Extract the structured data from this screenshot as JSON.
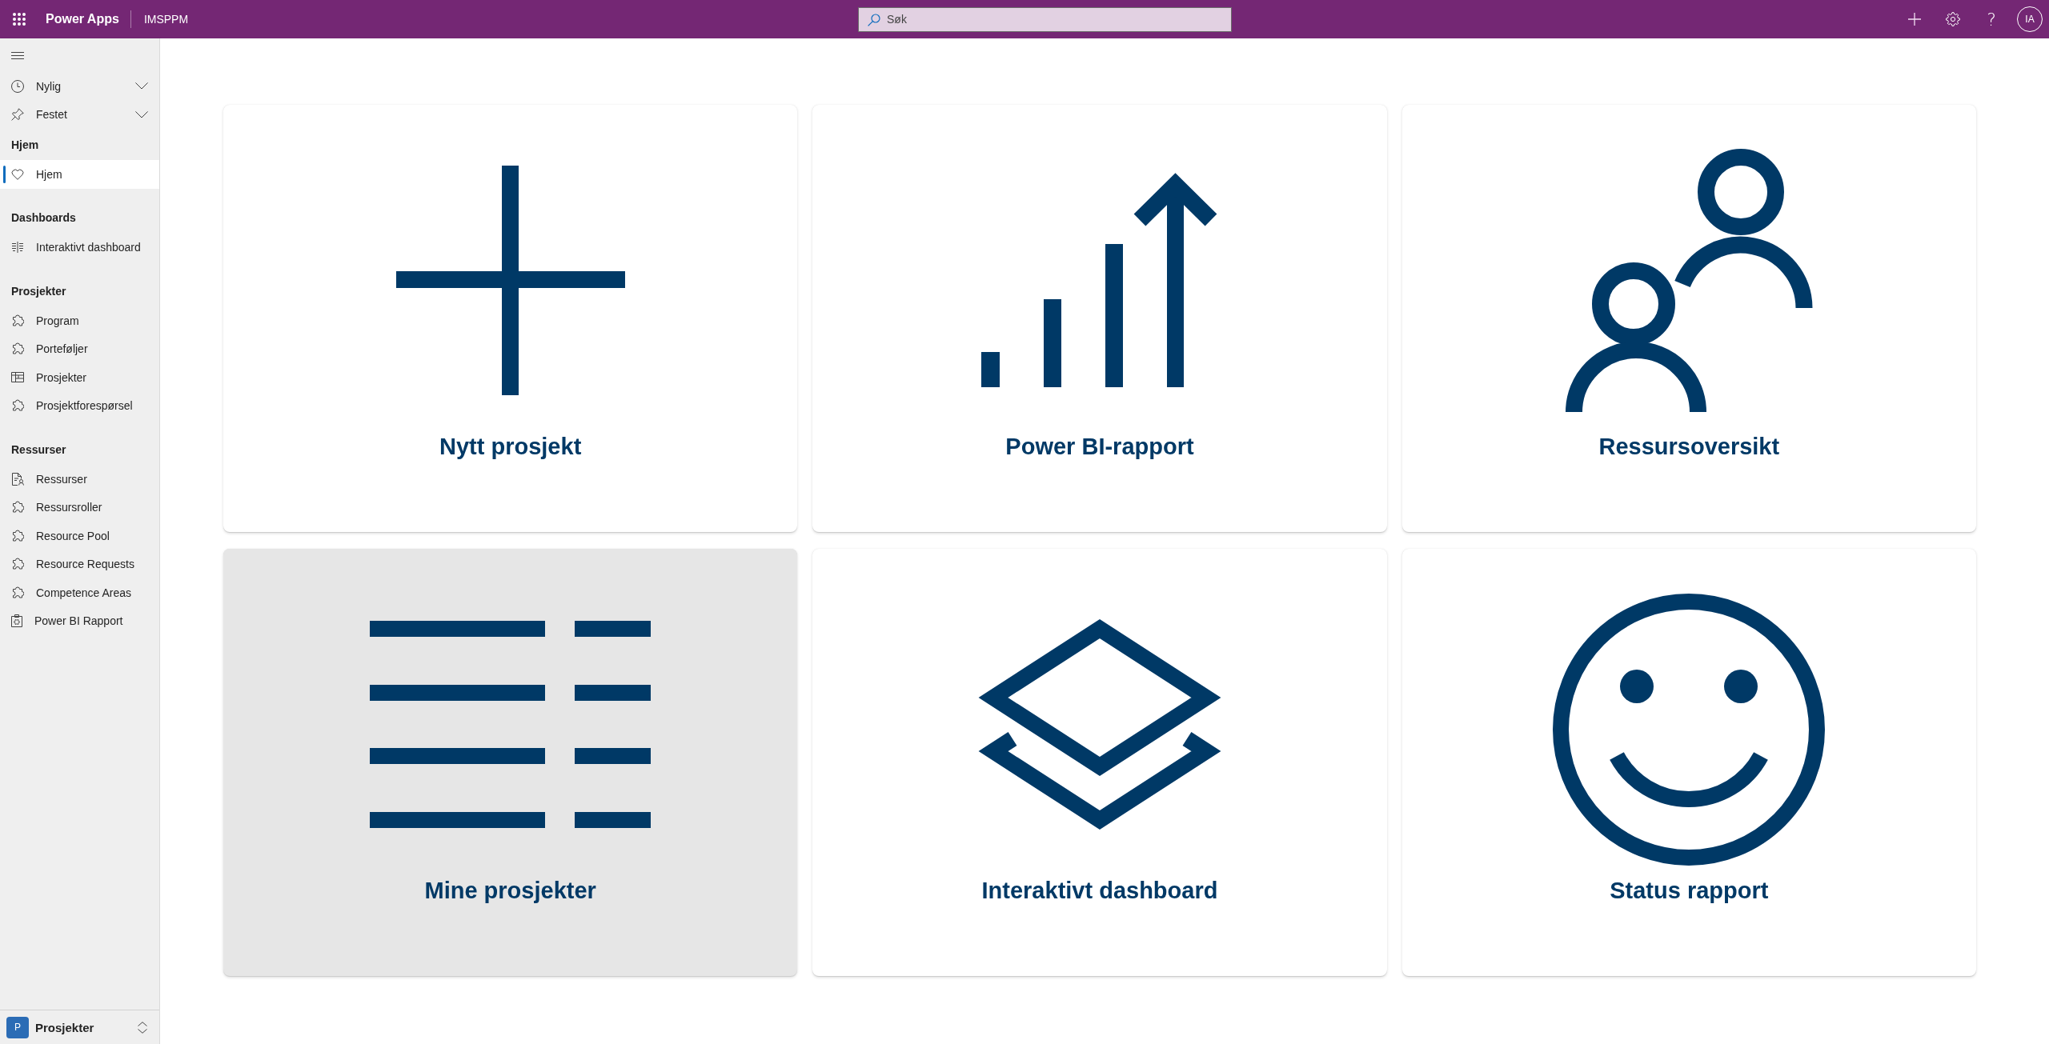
{
  "top_bar": {
    "app_name": "Power Apps",
    "environment": "IMSPPM",
    "search": {
      "placeholder": "Søk"
    },
    "help": "?",
    "avatar": "IA"
  },
  "sidebar": {
    "pinned_items": [
      {
        "label": "Nylig",
        "expanded": false
      },
      {
        "label": "Festet",
        "expanded": false
      }
    ],
    "sections": [
      {
        "heading": "Hjem",
        "items": [
          {
            "label": "Hjem",
            "selected": true
          }
        ]
      },
      {
        "heading": "Dashboards",
        "items": [
          {
            "label": "Interaktivt dashboard",
            "selected": false
          }
        ]
      },
      {
        "heading": "Prosjekter",
        "items": [
          {
            "label": "Program",
            "selected": false
          },
          {
            "label": "Porteføljer",
            "selected": false
          },
          {
            "label": "Prosjekter",
            "selected": false
          },
          {
            "label": "Prosjektforespørsel",
            "selected": false
          }
        ]
      },
      {
        "heading": "Ressurser",
        "items": [
          {
            "label": "Ressurser",
            "selected": false
          },
          {
            "label": "Ressursroller",
            "selected": false
          },
          {
            "label": "Resource Pool",
            "selected": false
          },
          {
            "label": "Resource Requests",
            "selected": false
          },
          {
            "label": "Competence Areas",
            "selected": false
          },
          {
            "label": "Power BI Rapport",
            "selected": false
          }
        ]
      }
    ],
    "area_switcher": {
      "badge": "P",
      "label": "Prosjekter"
    }
  },
  "tiles": [
    {
      "label": "Nytt prosjekt",
      "hovered": false
    },
    {
      "label": "Power BI-rapport",
      "hovered": false
    },
    {
      "label": "Ressursoversikt",
      "hovered": false
    },
    {
      "label": "Mine prosjekter",
      "hovered": true
    },
    {
      "label": "Interaktivt dashboard",
      "hovered": false
    },
    {
      "label": "Status rapport",
      "hovered": false
    }
  ]
}
